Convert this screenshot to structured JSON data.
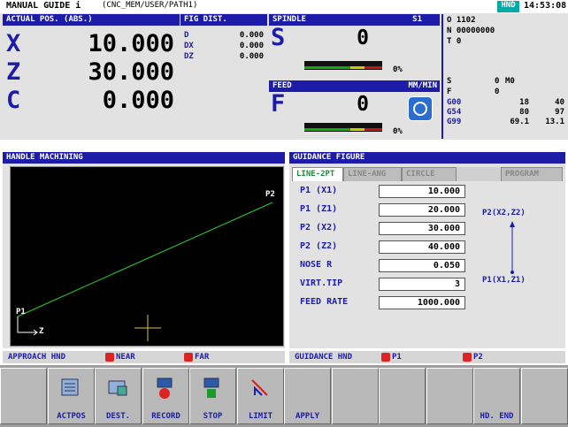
{
  "header": {
    "title": "MANUAL GUIDE i",
    "path": "(CNC_MEM/USER/PATH1)",
    "mode": "HND",
    "time": "14:53:08"
  },
  "position": {
    "title": "ACTUAL POS. (ABS.)",
    "axes": [
      {
        "name": "X",
        "value": "10.000"
      },
      {
        "name": "Z",
        "value": "30.000"
      },
      {
        "name": "C",
        "value": "0.000"
      }
    ]
  },
  "fig_dist": {
    "title": "FIG DIST.",
    "items": [
      {
        "label": "D",
        "value": "0.000"
      },
      {
        "label": "DX",
        "value": "0.000"
      },
      {
        "label": "DZ",
        "value": "0.000"
      }
    ]
  },
  "spindle": {
    "title": "SPINDLE",
    "id": "S1",
    "letter": "S",
    "value": "0",
    "percent": "0%",
    "level": 0
  },
  "feed": {
    "title": "FEED",
    "unit": "MM/MIN",
    "letter": "F",
    "value": "0",
    "percent": "0%",
    "level": 0
  },
  "modal": {
    "o": "O 1102",
    "n": "N 00000000",
    "t": "T 0",
    "s": "S",
    "s_val": "0",
    "m": "M0",
    "f": "F",
    "f_val": "0",
    "rows": [
      [
        "G00",
        "18",
        "40"
      ],
      [
        "G54",
        "80",
        "97"
      ],
      [
        "G99",
        "69.1",
        "13.1"
      ]
    ]
  },
  "handle_panel": {
    "title": "HANDLE MACHINING",
    "p2": "P2",
    "p1": "P1",
    "z_axis": "Z"
  },
  "approach": {
    "label": "APPROACH HND",
    "near": "NEAR",
    "far": "FAR"
  },
  "guidance": {
    "title": "GUIDANCE FIGURE",
    "tabs": [
      "LINE-2PT",
      "LINE-ANG",
      "CIRCLE",
      "PROGRAM"
    ],
    "fields": [
      {
        "label": "P1 (X1)",
        "value": "10.000"
      },
      {
        "label": "P1 (Z1)",
        "value": "20.000"
      },
      {
        "label": "P2 (X2)",
        "value": "30.000"
      },
      {
        "label": "P2 (Z2)",
        "value": "40.000"
      },
      {
        "label": "NOSE R",
        "value": "0.050"
      },
      {
        "label": "VIRT.TIP",
        "value": "3"
      },
      {
        "label": "FEED RATE",
        "value": "1000.000"
      }
    ],
    "diagram_p2": "P2(X2,Z2)",
    "diagram_p1": "P1(X1,Z1)"
  },
  "guidance_hnd": {
    "label": "GUIDANCE HND",
    "p1": "P1",
    "p2": "P2"
  },
  "softkeys": [
    {
      "label": "",
      "icon": "none"
    },
    {
      "label": "ACTPOS",
      "icon": "actpos-icon"
    },
    {
      "label": "DEST.",
      "icon": "dest-icon"
    },
    {
      "label": "RECORD",
      "icon": "record-icon"
    },
    {
      "label": "STOP",
      "icon": "stop-icon"
    },
    {
      "label": "LIMIT",
      "icon": "limit-icon"
    },
    {
      "label": "APPLY",
      "icon": "none"
    },
    {
      "label": "",
      "icon": "none"
    },
    {
      "label": "",
      "icon": "none"
    },
    {
      "label": "",
      "icon": "none"
    },
    {
      "label": "HD. END",
      "icon": "none"
    },
    {
      "label": "",
      "icon": "none"
    }
  ]
}
